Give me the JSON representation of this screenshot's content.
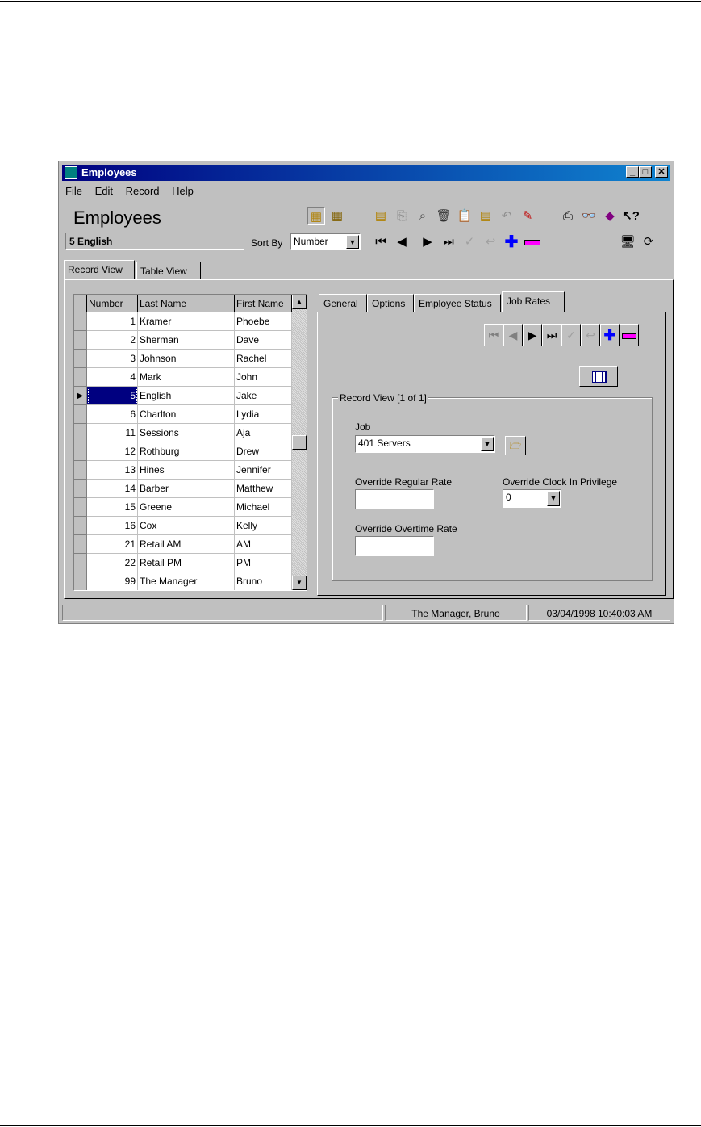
{
  "window": {
    "title": "Employees",
    "controls": {
      "minimize": "_",
      "maximize": "□",
      "close": "✕"
    }
  },
  "menu": [
    "File",
    "Edit",
    "Record",
    "Help"
  ],
  "header": {
    "title": "Employees",
    "current_record": "5  English",
    "sort_by_label": "Sort By",
    "sort_by_value": "Number"
  },
  "view_tabs": [
    "Record View",
    "Table View"
  ],
  "table": {
    "columns": [
      "Number",
      "Last Name",
      "First Name"
    ],
    "selected_index": 4,
    "rows": [
      {
        "number": "1",
        "last": "Kramer",
        "first": "Phoebe"
      },
      {
        "number": "2",
        "last": "Sherman",
        "first": "Dave"
      },
      {
        "number": "3",
        "last": "Johnson",
        "first": "Rachel"
      },
      {
        "number": "4",
        "last": "Mark",
        "first": "John"
      },
      {
        "number": "5",
        "last": "English",
        "first": "Jake"
      },
      {
        "number": "6",
        "last": "Charlton",
        "first": "Lydia"
      },
      {
        "number": "11",
        "last": "Sessions",
        "first": "Aja"
      },
      {
        "number": "12",
        "last": "Rothburg",
        "first": "Drew"
      },
      {
        "number": "13",
        "last": "Hines",
        "first": "Jennifer"
      },
      {
        "number": "14",
        "last": "Barber",
        "first": "Matthew"
      },
      {
        "number": "15",
        "last": "Greene",
        "first": "Michael"
      },
      {
        "number": "16",
        "last": "Cox",
        "first": "Kelly"
      },
      {
        "number": "21",
        "last": "Retail AM",
        "first": "AM"
      },
      {
        "number": "22",
        "last": "Retail PM",
        "first": "PM"
      },
      {
        "number": "99",
        "last": "The Manager",
        "first": "Bruno"
      }
    ]
  },
  "detail_tabs": [
    "General",
    "Options",
    "Employee Status",
    "Job Rates"
  ],
  "job_rates": {
    "group_title": "Record View  [1 of 1]",
    "job_label": "Job",
    "job_value": "401  Servers",
    "override_regular_rate_label": "Override Regular Rate",
    "override_regular_rate_value": "",
    "override_clock_label": "Override Clock In Privilege",
    "override_clock_value": "0",
    "override_overtime_rate_label": "Override Overtime Rate",
    "override_overtime_rate_value": ""
  },
  "status_bar": {
    "user": "The Manager, Bruno",
    "datetime": "03/04/1998 10:40:03 AM"
  },
  "toolbar_icons": [
    "record-view-icon",
    "table-view-icon",
    "new-record-icon",
    "copy-icon",
    "find-icon",
    "delete-icon",
    "clipboard-icon",
    "paste-icon",
    "undo-icon",
    "edit-icon",
    "print-icon",
    "binoculars-icon",
    "book-icon",
    "help-pointer-icon",
    "screen-icon",
    "refresh-icon"
  ],
  "colors": {
    "selected_row": "#000080",
    "add": "#0000ff",
    "remove": "#ff00ff"
  }
}
